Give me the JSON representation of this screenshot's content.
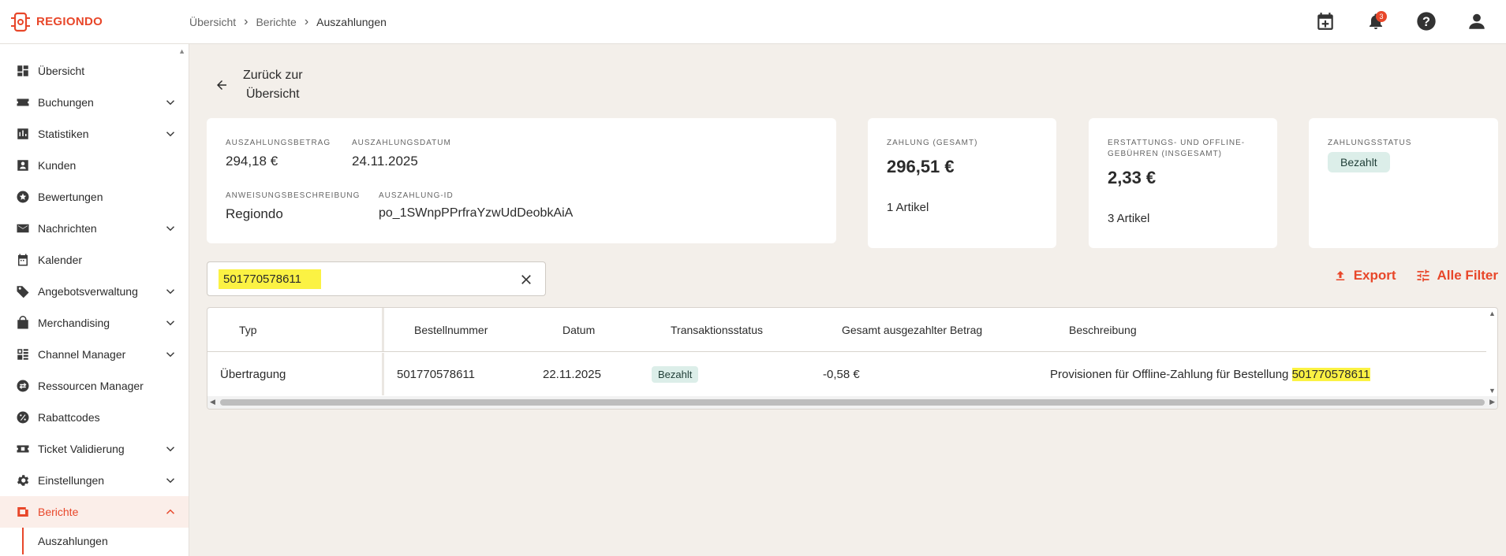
{
  "brand": {
    "name": "REGIONDO",
    "color": "#e8472a"
  },
  "breadcrumb": [
    "Übersicht",
    "Berichte",
    "Auszahlungen"
  ],
  "topbar": {
    "notifications_count": "3"
  },
  "sidebar": {
    "items": [
      {
        "label": "Übersicht",
        "icon": "dashboard-icon",
        "expandable": false
      },
      {
        "label": "Buchungen",
        "icon": "ticket-star-icon",
        "expandable": true
      },
      {
        "label": "Statistiken",
        "icon": "bar-chart-icon",
        "expandable": true
      },
      {
        "label": "Kunden",
        "icon": "person-box-icon",
        "expandable": false
      },
      {
        "label": "Bewertungen",
        "icon": "star-circle-icon",
        "expandable": false
      },
      {
        "label": "Nachrichten",
        "icon": "mail-icon",
        "expandable": true
      },
      {
        "label": "Kalender",
        "icon": "calendar-icon",
        "expandable": false
      },
      {
        "label": "Angebotsverwaltung",
        "icon": "tag-icon",
        "expandable": true
      },
      {
        "label": "Merchandising",
        "icon": "shopping-bag-icon",
        "expandable": true
      },
      {
        "label": "Channel Manager",
        "icon": "channels-icon",
        "expandable": true
      },
      {
        "label": "Ressourcen Manager",
        "icon": "swap-icon",
        "expandable": false
      },
      {
        "label": "Rabattcodes",
        "icon": "percent-icon",
        "expandable": false
      },
      {
        "label": "Ticket Validierung",
        "icon": "ticket-icon",
        "expandable": true
      },
      {
        "label": "Einstellungen",
        "icon": "gear-icon",
        "expandable": true
      },
      {
        "label": "Berichte",
        "icon": "report-icon",
        "expandable": true,
        "active": true
      }
    ],
    "subitem": "Auszahlungen"
  },
  "back": {
    "line1": "Zurück zur",
    "line2": "Übersicht"
  },
  "summary": {
    "betrag_label": "Auszahlungsbetrag",
    "betrag_value": "294,18 €",
    "datum_label": "Auszahlungsdatum",
    "datum_value": "24.11.2025",
    "beschreibung_label": "Anweisungsbeschreibung",
    "beschreibung_value": "Regiondo",
    "id_label": "Auszahlung-ID",
    "id_value": "po_1SWnpPPrfraYzwUdDeobkAiA"
  },
  "zahlung": {
    "label": "Zahlung (gesamt)",
    "value": "296,51 €",
    "items": "1 Artikel"
  },
  "gebuehren": {
    "label_line1": "Erstattungs- und Offline-",
    "label_line2": "Gebühren (insgesamt)",
    "value": "2,33 €",
    "items": "3 Artikel"
  },
  "status": {
    "label": "Zahlungsstatus",
    "value": "Bezahlt"
  },
  "search": {
    "value": "501770578611"
  },
  "actions": {
    "export": "Export",
    "filters": "Alle Filter"
  },
  "table": {
    "headers": [
      "Typ",
      "Bestellnummer",
      "Datum",
      "Transaktionsstatus",
      "Gesamt ausgezahlter Betrag",
      "Beschreibung"
    ],
    "rows": [
      {
        "typ": "Übertragung",
        "bestellnummer": "501770578611",
        "datum": "22.11.2025",
        "status": "Bezahlt",
        "betrag": "-0,58 €",
        "beschreibung_prefix": "Provisionen für Offline-Zahlung für Bestellung",
        "beschreibung_match": "501770578611"
      }
    ]
  }
}
